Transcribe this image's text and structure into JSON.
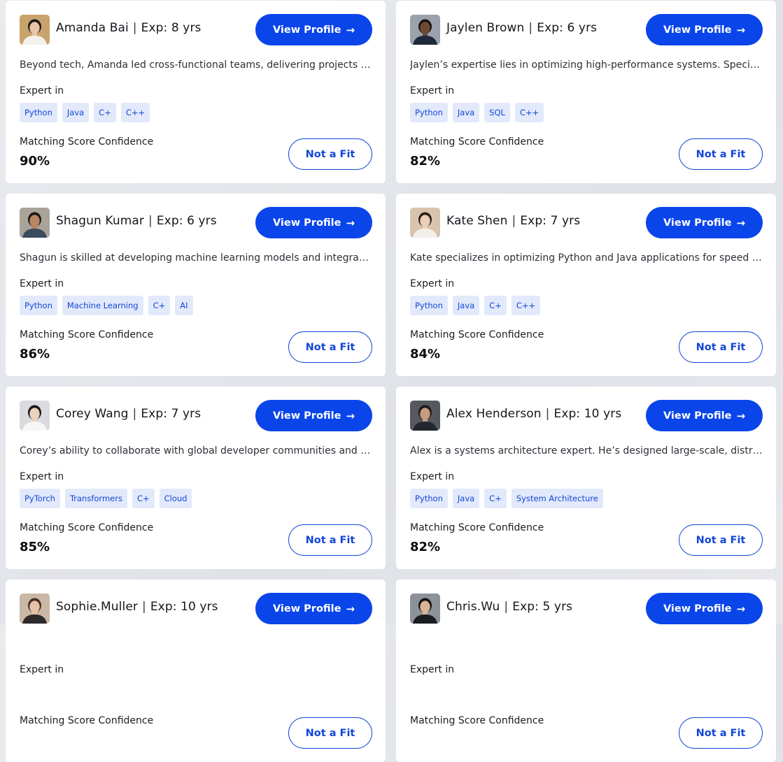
{
  "ui": {
    "view_profile_label": "View Profile",
    "not_fit_label": "Not a Fit",
    "expert_label": "Expert in",
    "score_label": "Matching Score Confidence",
    "exp_prefix": "Exp:",
    "separator": "|",
    "arrow_glyph": "→"
  },
  "colors": {
    "accent": "#0a45ea",
    "tag_bg": "#e2e9fb",
    "tag_text": "#1346d6",
    "page_bg": "#e3e6ea"
  },
  "candidates": [
    {
      "name": "Amanda Bai",
      "exp": "8 yrs",
      "bio": "Beyond tech, Amanda led cross-functional teams, delivering projects on time and exceeding client expectations.",
      "skills": [
        "Python",
        "Java",
        "C+",
        "C++"
      ],
      "score": "90%",
      "avatar": {
        "skin": "#e8c4a8",
        "hair": "#1e1a18",
        "shirt": "#f4f1ec",
        "bg": "#c9a36c"
      }
    },
    {
      "name": "Jaylen Brown",
      "exp": "6 yrs",
      "bio": "Jaylen’s expertise lies in optimizing high-performance systems. Specializing in backend scalability.",
      "skills": [
        "Python",
        "Java",
        "SQL",
        "C++"
      ],
      "score": "82%",
      "avatar": {
        "skin": "#6e4a35",
        "hair": "#1a1412",
        "shirt": "#1e2a3c",
        "bg": "#9aa2ad"
      }
    },
    {
      "name": "Shagun Kumar",
      "exp": "6 yrs",
      "bio": "Shagun is skilled at developing machine learning models and integrating them into production systems.",
      "skills": [
        "Python",
        "Machine Learning",
        "C+",
        "AI"
      ],
      "score": "86%",
      "avatar": {
        "skin": "#b88664",
        "hair": "#1d1714",
        "shirt": "#3b4a5c",
        "bg": "#a9a39a"
      }
    },
    {
      "name": "Kate Shen",
      "exp": "7 yrs",
      "bio": "Kate specializes in optimizing Python and Java applications for speed and reliability at scale.",
      "skills": [
        "Python",
        "Java",
        "C+",
        "C++"
      ],
      "score": "84%",
      "avatar": {
        "skin": "#edcfb8",
        "hair": "#2a1f1a",
        "shirt": "#f2efe9",
        "bg": "#d8c4ae"
      }
    },
    {
      "name": "Corey Wang",
      "exp": "7 yrs",
      "bio": "Corey’s ability to collaborate with global developer communities and open-source projects stands out.",
      "skills": [
        "PyTorch",
        "Transformers",
        "C+",
        "Cloud"
      ],
      "score": "85%",
      "avatar": {
        "skin": "#ecd2bd",
        "hair": "#1c1816",
        "shirt": "#f6f6f6",
        "bg": "#d9dbde"
      }
    },
    {
      "name": "Alex Henderson",
      "exp": "10 yrs",
      "bio": "Alex is a systems architecture expert. He’s designed large-scale, distributed platforms for enterprises.",
      "skills": [
        "Python",
        "Java",
        "C+",
        "System Architecture"
      ],
      "score": "82%",
      "avatar": {
        "skin": "#c99c7e",
        "hair": "#1f1a17",
        "shirt": "#22262e",
        "bg": "#55595f"
      }
    },
    {
      "name": "Sophie.Muller",
      "exp": "10 yrs",
      "bio": "",
      "skills": [],
      "score": "",
      "avatar": {
        "skin": "#e6c2a6",
        "hair": "#4a2f22",
        "shirt": "#2d2a2a",
        "bg": "#c9b8a6"
      }
    },
    {
      "name": "Chris.Wu",
      "exp": "5 yrs",
      "bio": "",
      "skills": [],
      "score": "",
      "avatar": {
        "skin": "#d9b497",
        "hair": "#151210",
        "shirt": "#1b1c20",
        "bg": "#8d9299"
      }
    }
  ]
}
